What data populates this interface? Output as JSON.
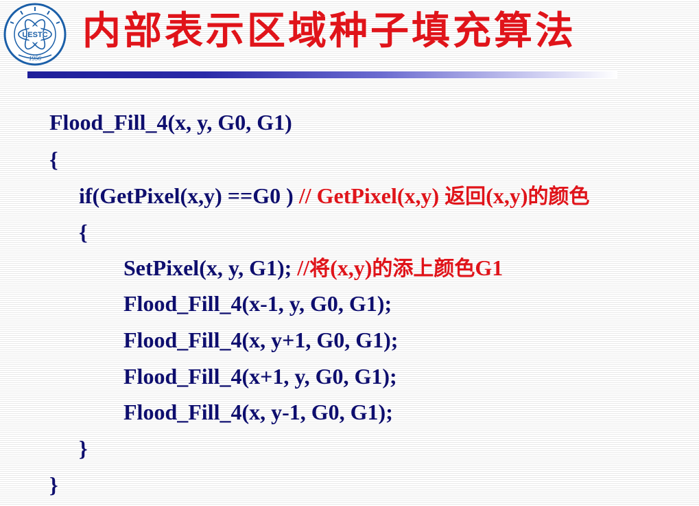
{
  "slide": {
    "title": "内部表示区域种子填充算法",
    "logo": {
      "text": "UESTC",
      "year": "1956"
    },
    "code": {
      "signature": "Flood_Fill_4(x, y, G0, G1)",
      "open_brace_outer": "{",
      "if_line": "if(GetPixel(x,y) ==G0 ) ",
      "if_comment_prefix": "// GetPixel(x,y) ",
      "if_comment_cjk_1": "返回",
      "if_comment_mid": "(x,y)",
      "if_comment_cjk_2": "的颜色",
      "open_brace_inner": "{",
      "set_pixel": "SetPixel(x, y, G1);  ",
      "set_comment_prefix": "//",
      "set_comment_cjk_1": "将",
      "set_comment_mid": "(x,y)",
      "set_comment_cjk_2": "的添上颜色",
      "set_comment_suffix": "G1",
      "call_1": "Flood_Fill_4(x-1, y, G0, G1);",
      "call_2": "Flood_Fill_4(x, y+1, G0, G1);",
      "call_3": "Flood_Fill_4(x+1, y, G0, G1);",
      "call_4": "Flood_Fill_4(x, y-1, G0, G1);",
      "close_brace_inner": "}",
      "close_brace_outer": "}"
    }
  },
  "colors": {
    "title": "#e0141a",
    "code": "#0e0e6e",
    "comment": "#e0141a",
    "bar": "#1f1f9a",
    "logo": "#1b5fa8"
  }
}
